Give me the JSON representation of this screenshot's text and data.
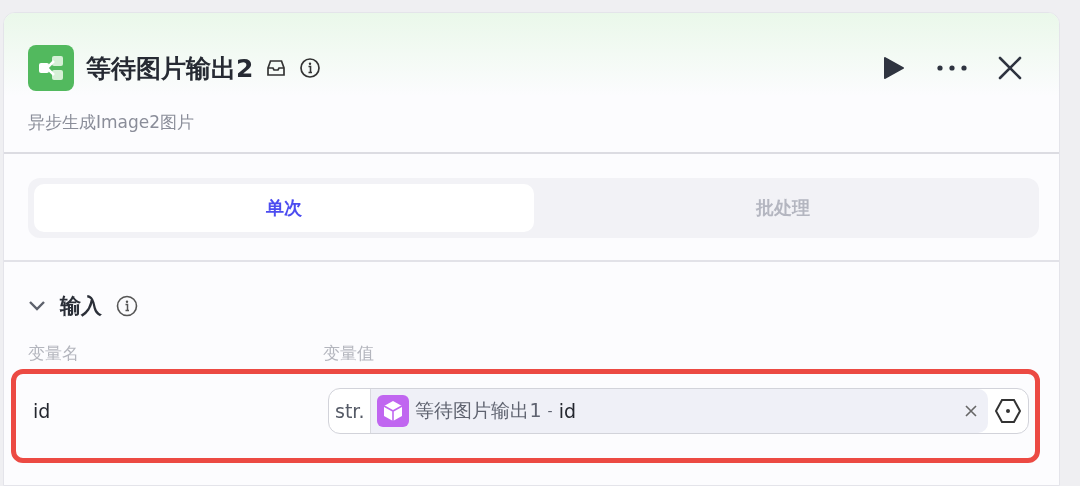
{
  "node": {
    "title": "等待图片输出2",
    "description": "异步生成Image2图片"
  },
  "tabs": [
    {
      "label": "单次",
      "selected": true
    },
    {
      "label": "批处理",
      "selected": false
    }
  ],
  "section": {
    "title": "输入",
    "expanded": true,
    "columns": [
      "变量名",
      "变量值"
    ],
    "rows": [
      {
        "name": "id",
        "highlighted": true,
        "value": {
          "type": "str.",
          "source": "等待图片输出1",
          "separator": "-",
          "field": "id"
        }
      }
    ]
  }
}
